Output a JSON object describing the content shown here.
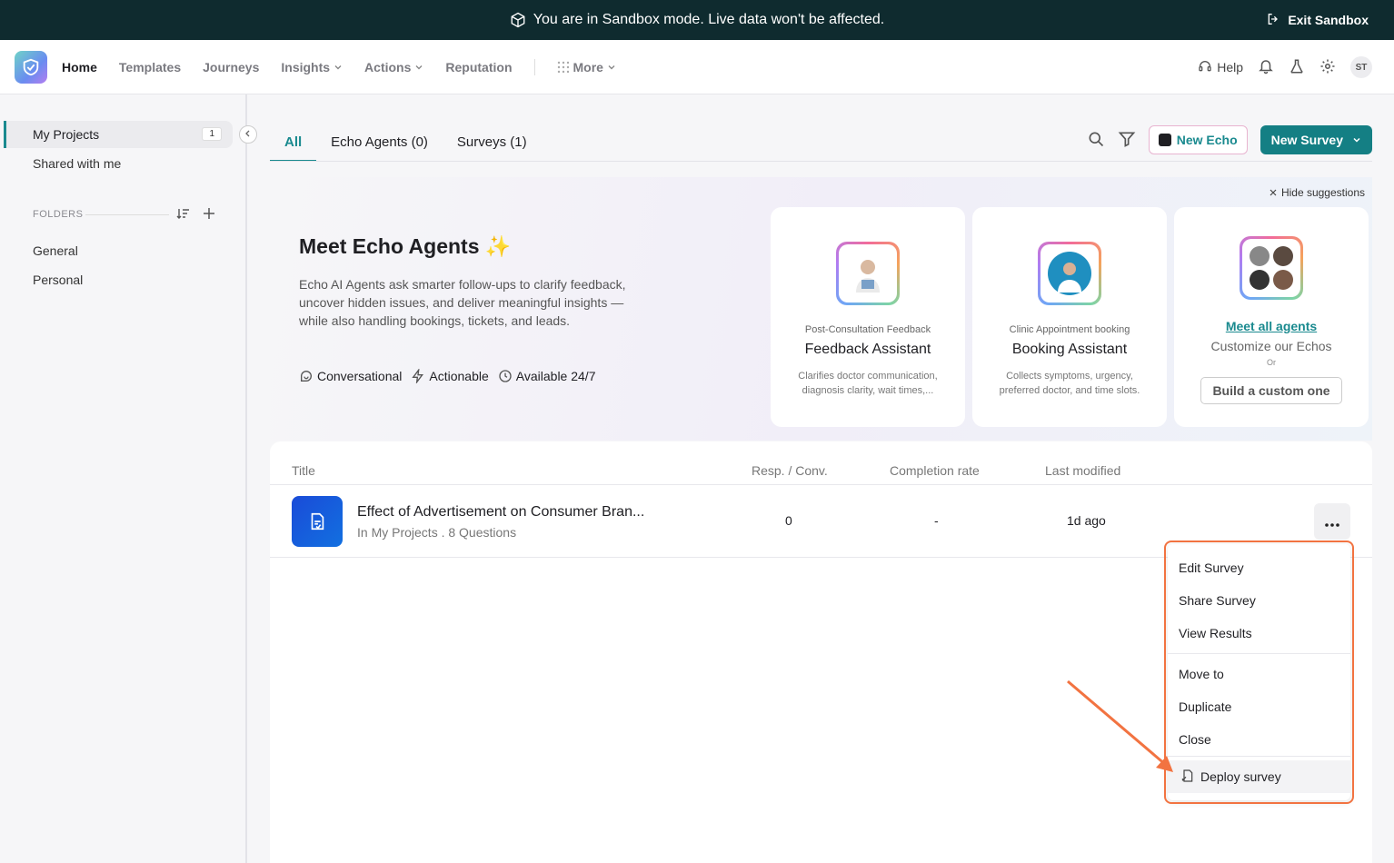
{
  "banner": {
    "message": "You are in Sandbox mode. Live data won't be affected.",
    "exit_label": "Exit Sandbox"
  },
  "nav": {
    "items": [
      {
        "label": "Home"
      },
      {
        "label": "Templates"
      },
      {
        "label": "Journeys"
      },
      {
        "label": "Insights"
      },
      {
        "label": "Actions"
      },
      {
        "label": "Reputation"
      },
      {
        "label": "More"
      }
    ],
    "help_label": "Help",
    "avatar_initials": "ST"
  },
  "sidebar": {
    "items": [
      {
        "label": "My Projects",
        "count": "1"
      },
      {
        "label": "Shared with me"
      }
    ],
    "folders_label": "FOLDERS",
    "folders": [
      {
        "label": "General"
      },
      {
        "label": "Personal"
      }
    ]
  },
  "tabs": [
    {
      "label": "All"
    },
    {
      "label": "Echo Agents (0)"
    },
    {
      "label": "Surveys (1)"
    }
  ],
  "toolbar": {
    "new_echo_label": "New Echo",
    "new_survey_label": "New Survey"
  },
  "suggestions": {
    "hide_label": "Hide suggestions",
    "title": "Meet Echo Agents",
    "description": "Echo AI Agents ask smarter follow-ups to clarify feedback, uncover hidden issues, and deliver meaningful insights — while also handling bookings, tickets, and leads.",
    "features": [
      "Conversational",
      "Actionable",
      "Available 24/7"
    ],
    "cards": [
      {
        "subtitle": "Post-Consultation Feedback",
        "name": "Feedback Assistant",
        "description": "Clarifies doctor communication, diagnosis clarity, wait times,..."
      },
      {
        "subtitle": "Clinic Appointment booking",
        "name": "Booking Assistant",
        "description": "Collects symptoms, urgency, preferred doctor, and time slots."
      }
    ],
    "meet_all": {
      "link": "Meet all agents",
      "subtitle": "Customize our Echos",
      "or": "Or",
      "button": "Build a custom one"
    }
  },
  "table": {
    "columns": [
      "Title",
      "Resp. / Conv.",
      "Completion rate",
      "Last modified"
    ],
    "rows": [
      {
        "title": "Effect of Advertisement on Consumer Bran...",
        "subtitle": "In My Projects . 8 Questions",
        "responses": "0",
        "completion": "-",
        "modified": "1d ago"
      }
    ]
  },
  "context_menu": {
    "items": [
      "Edit Survey",
      "Share Survey",
      "View Results",
      "Move to",
      "Duplicate",
      "Close",
      "Deploy survey"
    ]
  },
  "colors": {
    "accent": "#147f84",
    "banner": "#0f2b2f",
    "highlight": "#f27341",
    "survey_icon": "#1a4bd8"
  }
}
